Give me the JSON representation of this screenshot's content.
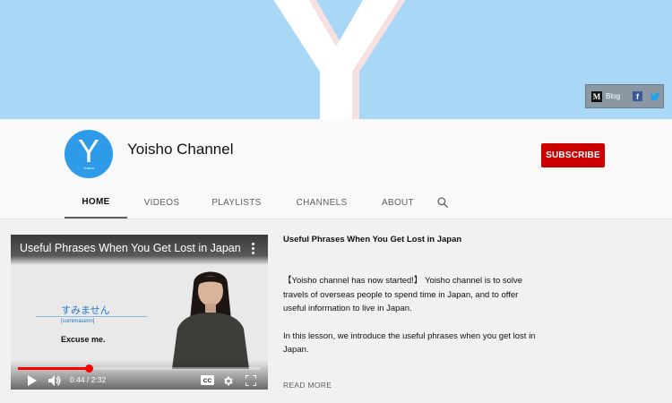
{
  "banner": {
    "colors": {
      "sky": "#a9d8f7",
      "letter": "#ffffff",
      "shadow": "#f6e0e0"
    },
    "social": {
      "medium_letter": "M",
      "blog_label": "Blog",
      "facebook_letter": "f",
      "icons": [
        "medium-icon",
        "facebook-icon",
        "twitter-icon"
      ]
    }
  },
  "channel": {
    "avatar_letter": "Y",
    "avatar_caption": "Yoisho",
    "name": "Yoisho Channel",
    "subscribe_label": "SUBSCRIBE",
    "colors": {
      "avatar": "#2d9be8",
      "subscribe": "#cc0000"
    }
  },
  "tabs": [
    {
      "label": "HOME",
      "active": true
    },
    {
      "label": "VIDEOS",
      "active": false
    },
    {
      "label": "PLAYLISTS",
      "active": false
    },
    {
      "label": "CHANNELS",
      "active": false
    },
    {
      "label": "ABOUT",
      "active": false
    }
  ],
  "featured": {
    "video": {
      "title": "Useful Phrases When You Get Lost in Japan",
      "card_japanese": "すみません",
      "card_romaji": "[sumimasenn]",
      "card_english": "Excuse me.",
      "time": "0:44 / 2:32",
      "progress": 0.29,
      "cc_label": "CC"
    },
    "description": {
      "title": "Useful Phrases When You Get Lost in Japan",
      "paragraph1": "【Yoisho channel has now started!】 Yoisho channel is to solve travels of overseas people to spend time in Japan, and to offer useful information to live in Japan.",
      "paragraph2": "In this lesson, we introduce the useful phrases when you get lost in Japan.",
      "read_more": "READ MORE"
    }
  }
}
